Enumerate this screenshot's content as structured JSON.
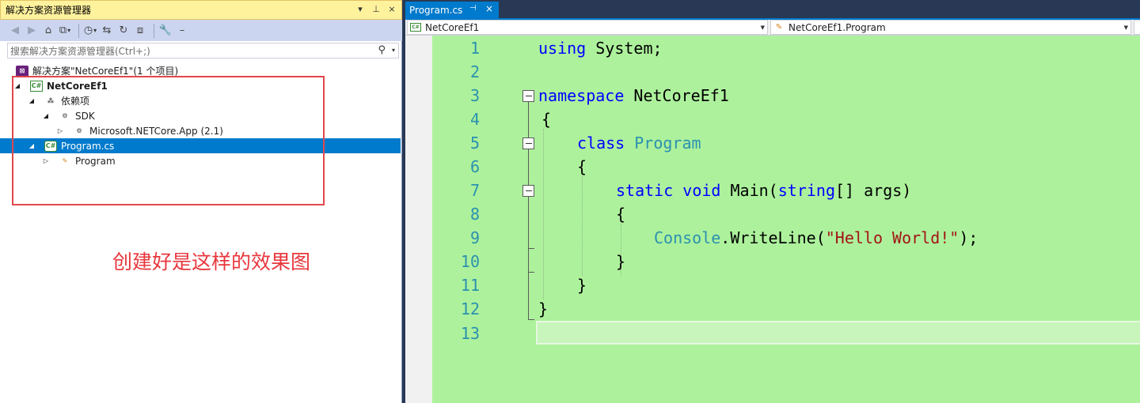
{
  "solution_explorer": {
    "title": "解决方案资源管理器",
    "title_actions": [
      "▾",
      "⊥",
      "×"
    ],
    "search_placeholder": "搜索解决方案资源管理器(Ctrl+;)",
    "tree": {
      "solution": "解决方案\"NetCoreEf1\"(1 个项目)",
      "project": "NetCoreEf1",
      "dependencies": "依赖项",
      "sdk": "SDK",
      "package": "Microsoft.NETCore.App (2.1)",
      "file": "Program.cs",
      "class": "Program"
    },
    "icons": {
      "solution_glyph": "⊠",
      "project_glyph": "C#",
      "file_glyph": "C#"
    }
  },
  "annotation": {
    "text": "创建好是这样的效果图",
    "color": "#e0474c"
  },
  "editor": {
    "tab": {
      "label": "Program.cs",
      "pin": "⊣",
      "close": "×"
    },
    "nav": {
      "project": "NetCoreEf1",
      "type": "NetCoreEf1.Program"
    },
    "line_numbers": [
      "1",
      "2",
      "3",
      "4",
      "5",
      "6",
      "7",
      "8",
      "9",
      "10",
      "11",
      "12",
      "13"
    ],
    "code": {
      "l1_kw": "using",
      "l1_rest": " System;",
      "l3_kw": "namespace",
      "l3_rest": " NetCoreEf1",
      "l4": "{",
      "l5_kw": "class",
      "l5_type": "Program",
      "l6": "{",
      "l7_kw1": "static",
      "l7_kw2": "void",
      "l7_name": "Main(",
      "l7_kw3": "string",
      "l7_rest": "[] args)",
      "l8": "{",
      "l9_type": "Console",
      "l9_call": ".WriteLine(",
      "l9_str": "\"Hello World!\"",
      "l9_end": ");",
      "l10": "}",
      "l11": "}",
      "l12": "}"
    },
    "colors": {
      "background": "#adf19c",
      "keyword": "#0000ff",
      "type": "#2b91af",
      "string": "#a31515",
      "line_number": "#2b91af",
      "tab_accent": "#007acc"
    }
  }
}
